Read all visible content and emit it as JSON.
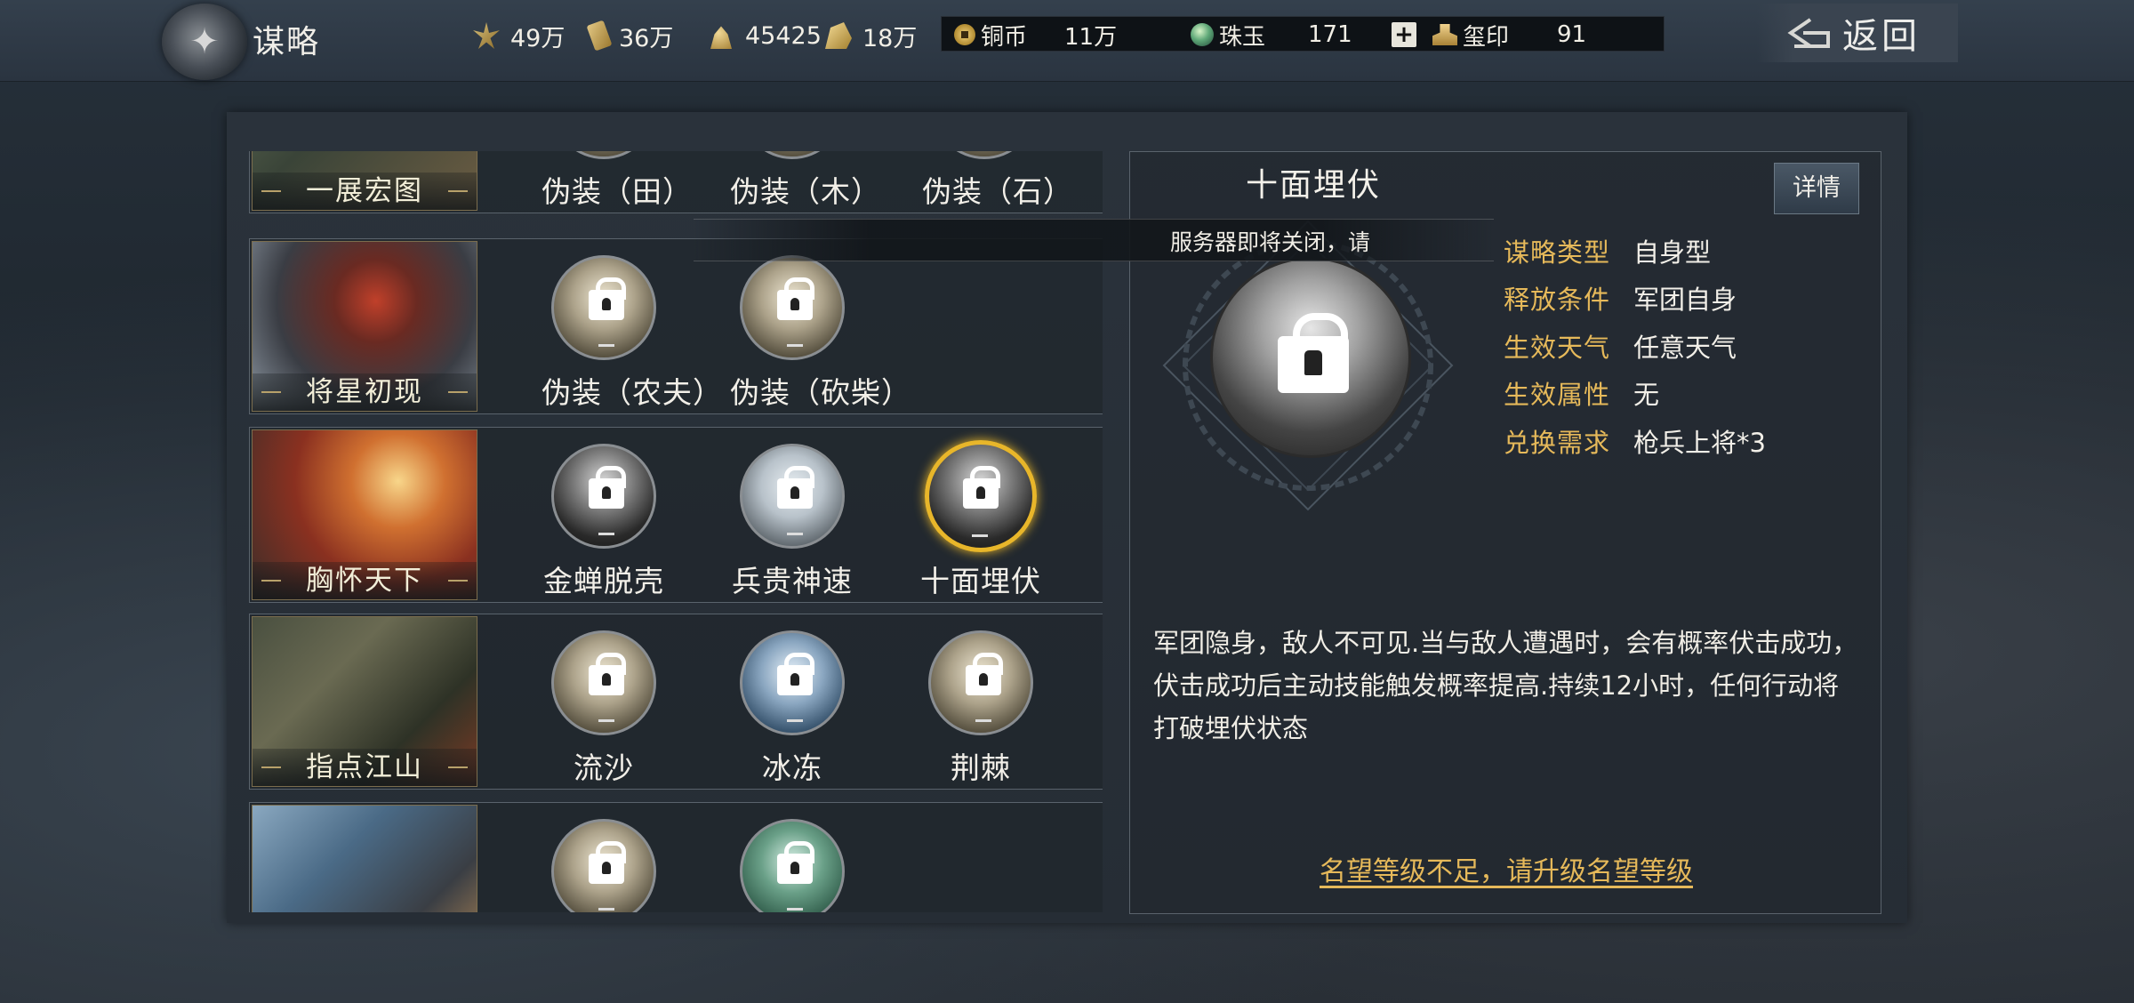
{
  "header": {
    "title": "谋略",
    "resources": [
      {
        "icon": "grain-icon",
        "value": "49万"
      },
      {
        "icon": "wood-icon",
        "value": "36万"
      },
      {
        "icon": "stone-icon",
        "value": "45425"
      },
      {
        "icon": "iron-icon",
        "value": "18万"
      }
    ],
    "currencies": [
      {
        "icon": "copper-coin-icon",
        "label": "铜币",
        "value": "11万"
      },
      {
        "icon": "jade-icon",
        "label": "珠玉",
        "value": "171"
      },
      {
        "icon": "seal-icon",
        "label": "玺印",
        "value": "91"
      }
    ],
    "add_label": "+",
    "back_label": "返回"
  },
  "toast": "服务器即将关闭，请",
  "stratagem_groups": [
    {
      "name": "一展宏图",
      "skills": [
        "伪装（田）",
        "伪装（木）",
        "伪装（石）"
      ]
    },
    {
      "name": "将星初现",
      "skills": [
        "伪装（农夫）",
        "伪装（砍柴）"
      ]
    },
    {
      "name": "胸怀天下",
      "skills": [
        "金蝉脱壳",
        "兵贵神速",
        "十面埋伏"
      ]
    },
    {
      "name": "指点江山",
      "skills": [
        "流沙",
        "冰冻",
        "荆棘"
      ]
    },
    {
      "name": "",
      "skills": [
        "",
        ""
      ]
    }
  ],
  "selected_skill": "十面埋伏",
  "detail": {
    "title": "十面埋伏",
    "detail_button": "详情",
    "attributes": [
      {
        "key": "谋略类型",
        "value": "自身型"
      },
      {
        "key": "释放条件",
        "value": "军团自身"
      },
      {
        "key": "生效天气",
        "value": "任意天气"
      },
      {
        "key": "生效属性",
        "value": "无"
      },
      {
        "key": "兑换需求",
        "value": "枪兵上将*3"
      }
    ],
    "description": "军团隐身，敌人不可见.当与敌人遭遇时，会有概率伏击成功，伏击成功后主动技能触发概率提高.持续12小时，任何行动将打破埋伏状态",
    "warning": "名望等级不足，请升级名望等级"
  },
  "colors": {
    "accent_gold": "#e6b95a",
    "selected_ring": "#e8b62a"
  }
}
